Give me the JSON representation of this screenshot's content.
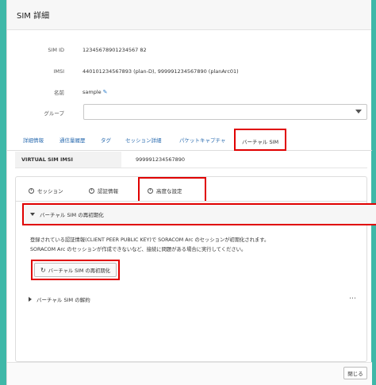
{
  "header": {
    "title": "SIM 詳細"
  },
  "info": {
    "sim_id": {
      "label": "SIM ID",
      "value": "12345678901234567 82"
    },
    "imsi": {
      "label": "IMSI",
      "value": "440101234567893 (plan-D), 999991234567890 (planArc01)"
    },
    "name": {
      "label": "名前",
      "value": "sample"
    },
    "group": {
      "label": "グループ",
      "value": ""
    }
  },
  "tabs": {
    "t1": "詳細情報",
    "t2": "通信量履歴",
    "t3": "タグ",
    "t4": "セッション詳細",
    "t5": "パケットキャプチャ",
    "t6": "バーチャル SIM"
  },
  "virtual_imsi": {
    "label": "VIRTUAL SIM IMSI",
    "value": "999991234567890"
  },
  "subtabs": {
    "session": "セッション",
    "auth": "認証情報",
    "advanced": "高度な設定"
  },
  "reinit": {
    "title": "バーチャル SIM の再初期化",
    "desc1": "登録されている認証情報(CLIENT PEER PUBLIC KEY)で SORACOM Arc のセッションが初期化されます。",
    "desc2": "SORACOM Arc のセッションが作成できないなど、接続に問題がある場合に実行してください。",
    "button": "バーチャル SIM の再初期化"
  },
  "dissolve": {
    "title": "バーチャル SIM の解約",
    "more": "…"
  },
  "footer": {
    "close": "閉じる"
  }
}
